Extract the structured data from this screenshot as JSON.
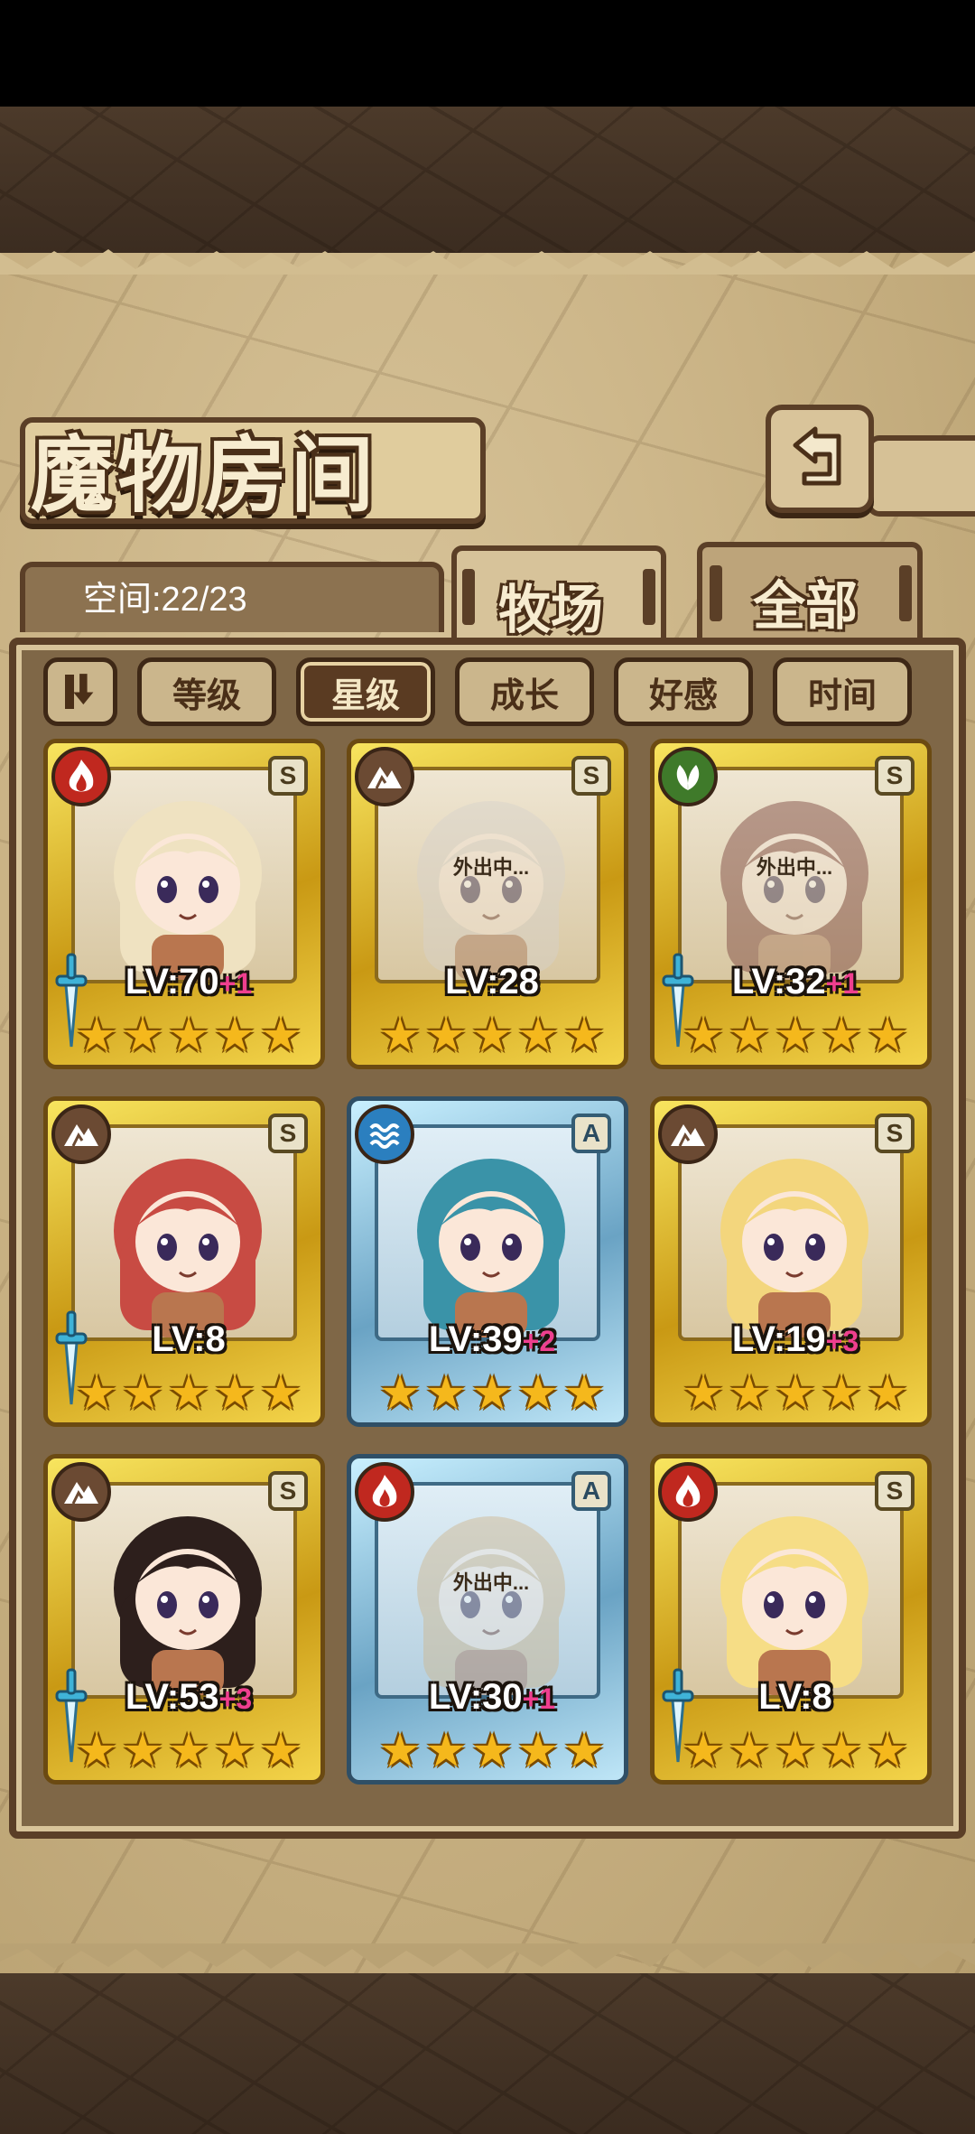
{
  "title": "魔物房间",
  "capacity": "空间:22/23",
  "tabs": [
    {
      "label": "牧场",
      "active": true
    },
    {
      "label": "全部",
      "active": false
    }
  ],
  "sort_buttons": [
    {
      "label": "等级",
      "selected": false
    },
    {
      "label": "星级",
      "selected": true
    },
    {
      "label": "成长",
      "selected": false
    },
    {
      "label": "好感",
      "selected": false
    },
    {
      "label": "时间",
      "selected": false
    }
  ],
  "monsters": [
    {
      "element": "fire",
      "rank": "S",
      "frame": "gold",
      "level": "LV:70",
      "bonus": "+1",
      "stars": 5,
      "away": "",
      "weapon": true,
      "hair": "#efe2c1"
    },
    {
      "element": "earth",
      "rank": "S",
      "frame": "gold",
      "level": "LV:28",
      "bonus": "",
      "stars": 5,
      "away": "外出中...",
      "weapon": false,
      "hair": "#d9d2c9"
    },
    {
      "element": "wood",
      "rank": "S",
      "frame": "gold",
      "level": "LV:32",
      "bonus": "+1",
      "stars": 5,
      "away": "外出中...",
      "weapon": true,
      "hair": "#8a3a32"
    },
    {
      "element": "earth",
      "rank": "S",
      "frame": "gold",
      "level": "LV:8",
      "bonus": "",
      "stars": 5,
      "away": "",
      "weapon": true,
      "hair": "#c84b43"
    },
    {
      "element": "water",
      "rank": "A",
      "frame": "silver",
      "level": "LV:39",
      "bonus": "+2",
      "stars": 5,
      "away": "",
      "weapon": false,
      "hair": "#3a93a8"
    },
    {
      "element": "earth",
      "rank": "S",
      "frame": "gold",
      "level": "LV:19",
      "bonus": "+3",
      "stars": 5,
      "away": "",
      "weapon": false,
      "hair": "#f3d67d"
    },
    {
      "element": "earth",
      "rank": "S",
      "frame": "gold",
      "level": "LV:53",
      "bonus": "+3",
      "stars": 5,
      "away": "",
      "weapon": true,
      "hair": "#2d1f1c"
    },
    {
      "element": "fire",
      "rank": "A",
      "frame": "silver",
      "level": "LV:30",
      "bonus": "+1",
      "stars": 5,
      "away": "外出中...",
      "weapon": false,
      "hair": "#d8b47a"
    },
    {
      "element": "fire",
      "rank": "S",
      "frame": "gold",
      "level": "LV:8",
      "bonus": "",
      "stars": 5,
      "away": "",
      "weapon": true,
      "hair": "#f6dd86"
    }
  ],
  "icons": {
    "back": "return-arrow-icon",
    "sort_toggle": "sort-order-icon",
    "fire": "flame-icon",
    "earth": "mountain-icon",
    "wood": "leaf-icon",
    "water": "wave-icon",
    "weapon": "sword-icon",
    "star": "star-icon"
  },
  "colors": {
    "parchment": "#c9b284",
    "frame_brown": "#5b3f27",
    "gold_frame": "#e9c533",
    "silver_frame": "#8ec5e0",
    "bonus": "#ef3f8f",
    "star": "#f5b81c"
  }
}
